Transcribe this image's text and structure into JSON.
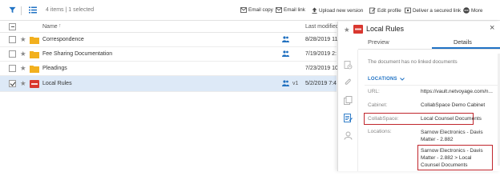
{
  "toolbar": {
    "count_text": "4 items | 1 selected",
    "actions": [
      {
        "label": "Email copy",
        "icon": "email-copy-icon"
      },
      {
        "label": "Email link",
        "icon": "email-link-icon"
      },
      {
        "label": "Upload new version",
        "icon": "upload-icon"
      },
      {
        "label": "Edit profile",
        "icon": "edit-profile-icon"
      },
      {
        "label": "Deliver a secured link",
        "icon": "deliver-link-icon"
      },
      {
        "label": "More",
        "icon": "more-icon"
      }
    ]
  },
  "list": {
    "columns": {
      "name": "Name",
      "sort_arrow": "↑",
      "modified": "Last modified"
    },
    "rows": [
      {
        "name": "Correspondence",
        "type": "folder",
        "shared": true,
        "version": "",
        "modified": "8/28/2019 11",
        "selected": false
      },
      {
        "name": "Fee Sharing Documentation",
        "type": "folder",
        "shared": true,
        "version": "",
        "modified": "7/19/2019 2:",
        "selected": false
      },
      {
        "name": "Pleadings",
        "type": "folder",
        "shared": false,
        "version": "",
        "modified": "7/23/2019 10",
        "selected": false
      },
      {
        "name": "Local Rules",
        "type": "pdf",
        "shared": true,
        "version": "v1",
        "modified": "5/2/2019 7:4",
        "selected": true
      }
    ]
  },
  "detail": {
    "title": "Local Rules",
    "close_glyph": "×",
    "tabs": {
      "preview": "Preview",
      "details": "Details",
      "active": "details"
    },
    "no_linked": "The document has no linked documents",
    "locations_header": "LOCATIONS",
    "url_label": "URL:",
    "url_value": "https://vault.netvoyage.com/n...",
    "cabinet_label": "Cabinet:",
    "cabinet_value": "CollabSpace Demo Cabinet",
    "collabspace_label": "CollabSpace:",
    "collabspace_value": "Local Counsel Documents",
    "locations_label": "Locations:",
    "location_1": "Sarnow Electronics - Davis Matter - 2.882",
    "location_2": "Sarnow Electronics - Davis Matter - 2.882 > Local Counsel Documents"
  },
  "colors": {
    "accent": "#1f72c4",
    "folder": "#f2b01e",
    "pdf": "#d9372f",
    "highlight_box": "#c0262c",
    "selected_row": "#dde9f7"
  }
}
